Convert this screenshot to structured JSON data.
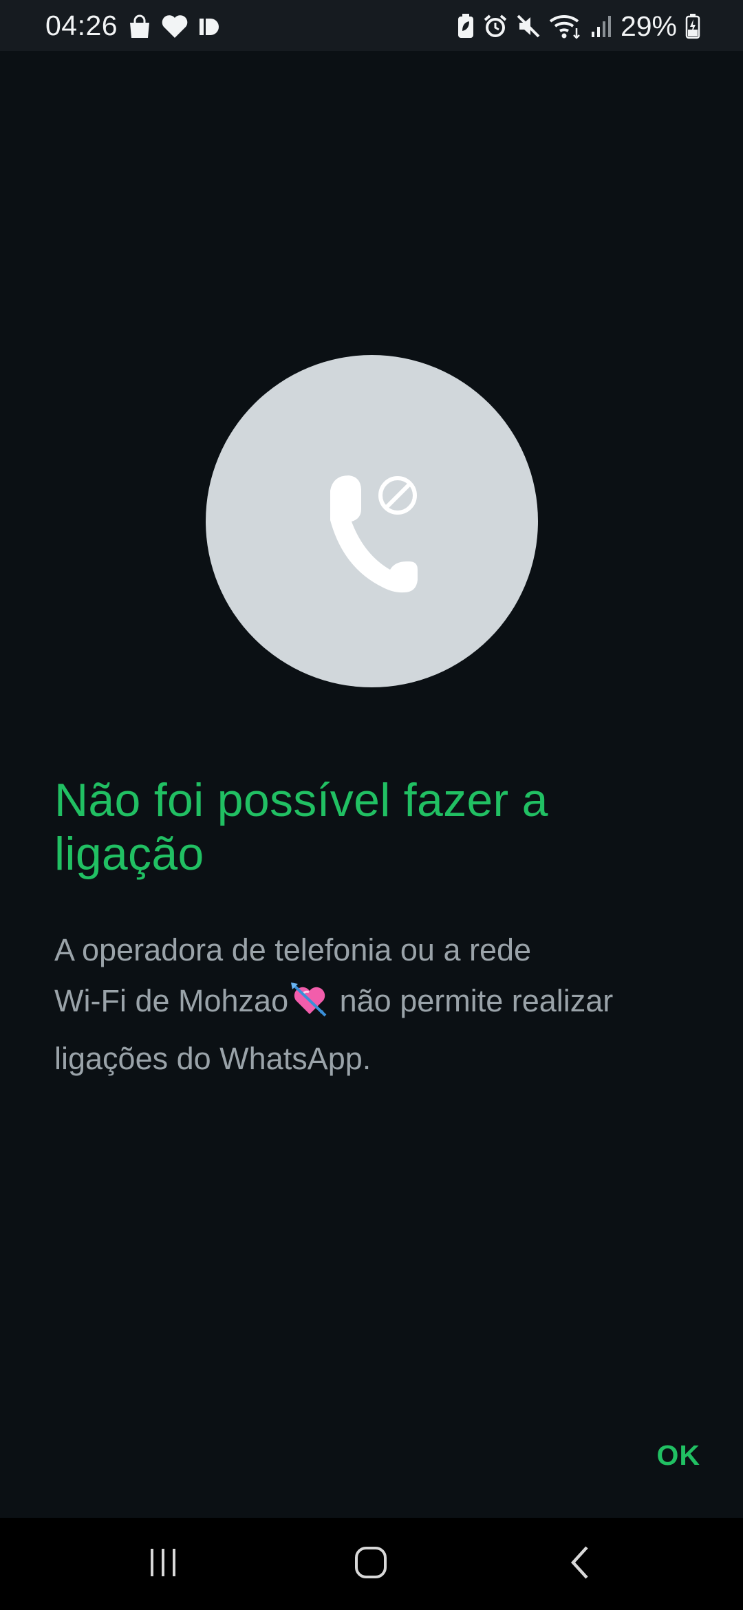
{
  "status_bar": {
    "time": "04:26",
    "battery_percent": "29%",
    "left_icons": [
      "shopping-bag-icon",
      "heart-icon",
      "app-notification-icon"
    ],
    "right_icons": [
      "battery-saver-icon",
      "alarm-icon",
      "mute-icon",
      "wifi-icon",
      "signal-icon",
      "battery-charging-icon"
    ]
  },
  "dialog": {
    "icon": "call-blocked-icon",
    "title": "Não foi possível fazer a ligação",
    "message_lines": [
      "A operadora de telefonia ou a rede",
      "Wi-Fi de Mohzao",
      "não permite realizar",
      "ligações do WhatsApp."
    ],
    "inline_emoji": "heart-with-arrow-emoji",
    "ok_label": "OK"
  },
  "nav_bar": {
    "buttons": [
      "recents-icon",
      "home-icon",
      "back-icon"
    ]
  },
  "colors": {
    "background": "#0b1014",
    "status_bar": "#161b20",
    "accent_green": "#21c063",
    "message_text": "#9aa3a9",
    "circle": "#d1d7db"
  }
}
